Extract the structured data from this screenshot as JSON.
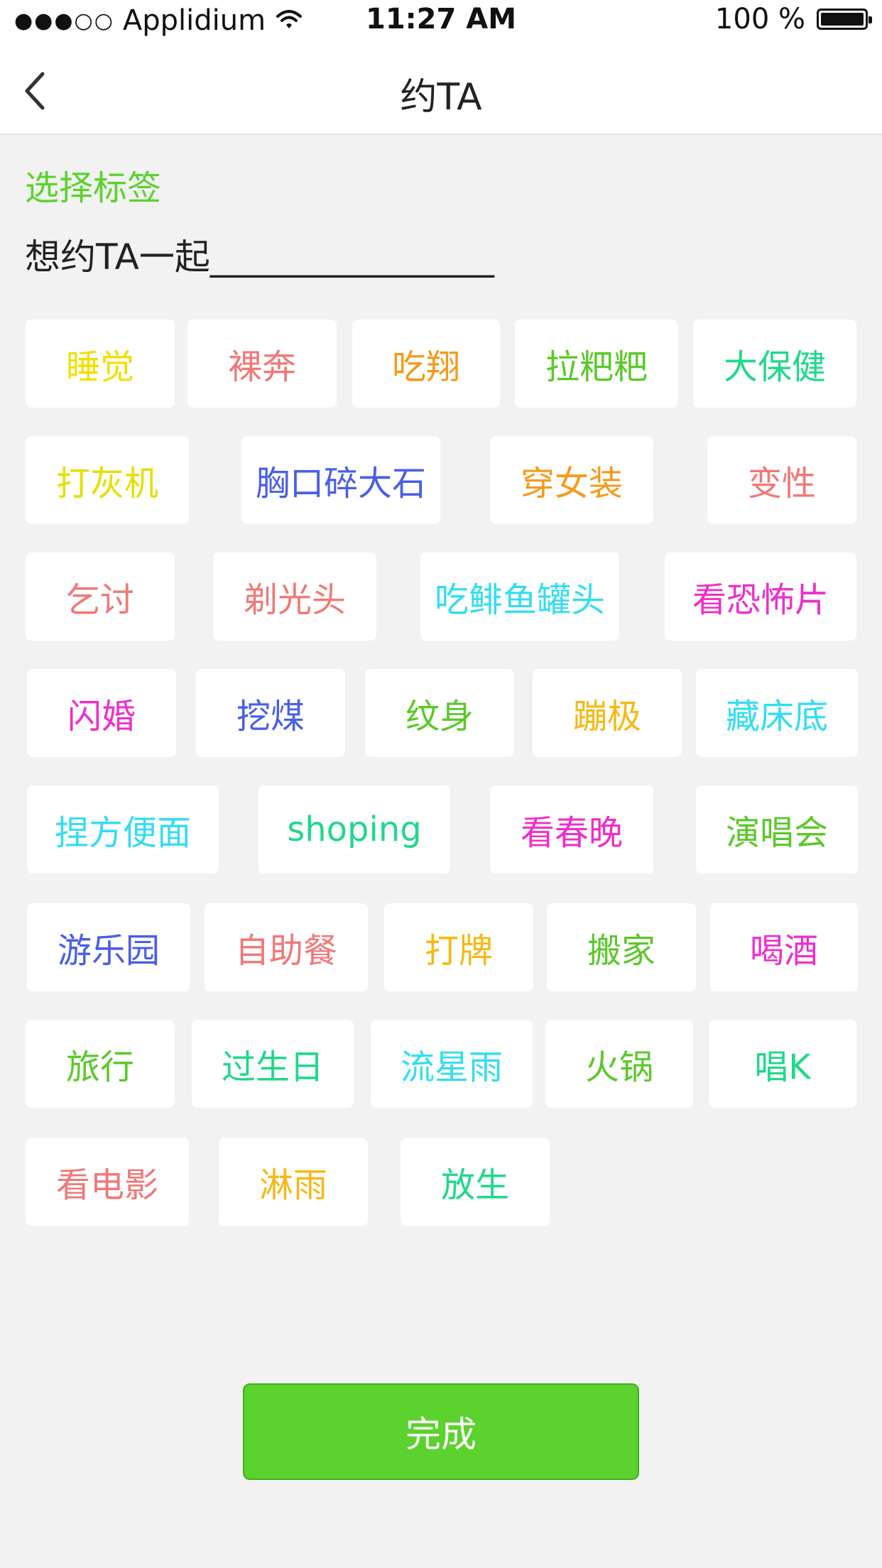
{
  "status_bar": {
    "carrier": "Applidium",
    "signal": "●●●○○",
    "time": "11:27 AM",
    "battery": "100 %"
  },
  "nav": {
    "title": "约TA",
    "back_icon": "chevron-left-icon"
  },
  "section_label": "选择标签",
  "prompt": "想约TA一起________________",
  "colors": {
    "accent": "#5bd22d",
    "background": "#f2f2f2",
    "card": "#ffffff"
  },
  "tags": [
    {
      "label": "睡觉",
      "color": "#f0e000"
    },
    {
      "label": "裸奔",
      "color": "#f07878"
    },
    {
      "label": "吃翔",
      "color": "#f59a1a"
    },
    {
      "label": "拉粑粑",
      "color": "#5bc82a"
    },
    {
      "label": "大保健",
      "color": "#20d88a"
    },
    {
      "label": "打灰机",
      "color": "#e4e000"
    },
    {
      "label": "胸口碎大石",
      "color": "#4a5ee6"
    },
    {
      "label": "穿女装",
      "color": "#f59a1a"
    },
    {
      "label": "变性",
      "color": "#f07878"
    },
    {
      "label": "乞讨",
      "color": "#f07878"
    },
    {
      "label": "剃光头",
      "color": "#f07878"
    },
    {
      "label": "吃鲱鱼罐头",
      "color": "#33ddf0"
    },
    {
      "label": "看恐怖片",
      "color": "#ee2ecb"
    },
    {
      "label": "闪婚",
      "color": "#ee2ecb"
    },
    {
      "label": "挖煤",
      "color": "#4a5ee6"
    },
    {
      "label": "纹身",
      "color": "#5bc82a"
    },
    {
      "label": "蹦极",
      "color": "#f5b915"
    },
    {
      "label": "藏床底",
      "color": "#33ddf0"
    },
    {
      "label": "捏方便面",
      "color": "#33ddf0"
    },
    {
      "label": "shoping",
      "color": "#20d88a"
    },
    {
      "label": "看春晚",
      "color": "#ee2ecb"
    },
    {
      "label": "演唱会",
      "color": "#5bc82a"
    },
    {
      "label": "游乐园",
      "color": "#4a5ee6"
    },
    {
      "label": "自助餐",
      "color": "#f07878"
    },
    {
      "label": "打牌",
      "color": "#f5b915"
    },
    {
      "label": "搬家",
      "color": "#5bc82a"
    },
    {
      "label": "喝酒",
      "color": "#ee2ecb"
    },
    {
      "label": "旅行",
      "color": "#5bc82a"
    },
    {
      "label": "过生日",
      "color": "#20d88a"
    },
    {
      "label": "流星雨",
      "color": "#33ddf0"
    },
    {
      "label": "火锅",
      "color": "#5bc82a"
    },
    {
      "label": "唱K",
      "color": "#20d88a"
    },
    {
      "label": "看电影",
      "color": "#f07878"
    },
    {
      "label": "淋雨",
      "color": "#f5b915"
    },
    {
      "label": "放生",
      "color": "#20d88a"
    }
  ],
  "done_label": "完成"
}
